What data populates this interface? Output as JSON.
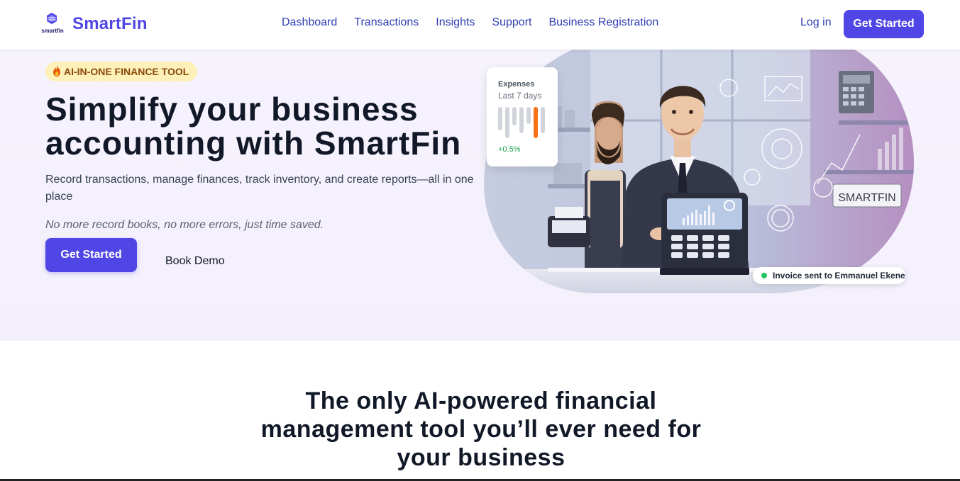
{
  "brand": {
    "name": "SmartFin",
    "mark_text": "smartfin",
    "color": "#4f46e5"
  },
  "nav": {
    "links": [
      "Dashboard",
      "Transactions",
      "Insights",
      "Support",
      "Business Registration"
    ],
    "login": "Log in",
    "cta": "Get Started"
  },
  "hero": {
    "badge": "AI-IN-ONE FINANCE TOOL",
    "title": "Simplify your business accounting with SmartFin",
    "subtitle": "Record transactions, manage finances, track inventory, and create reports—all in one place",
    "note": "No more record books, no more errors, just time saved.",
    "cta": "Get Started",
    "secondary": "Book Demo",
    "illustration_sign": "SMARTFIN"
  },
  "expenses_card": {
    "title": "Expenses",
    "period": "Last 7 days",
    "change": "+0.5%",
    "bars": [
      0.75,
      1.0,
      0.6,
      0.85,
      0.55,
      1.0,
      0.85
    ],
    "highlight_index": 5,
    "highlight_color": "#f97316",
    "bar_color": "#d1d5db"
  },
  "toast": {
    "text": "Invoice sent to Emmanuel Ekene",
    "status_color": "#22c55e"
  },
  "section": {
    "title": "The only AI-powered financial management tool you’ll ever need for your business"
  }
}
